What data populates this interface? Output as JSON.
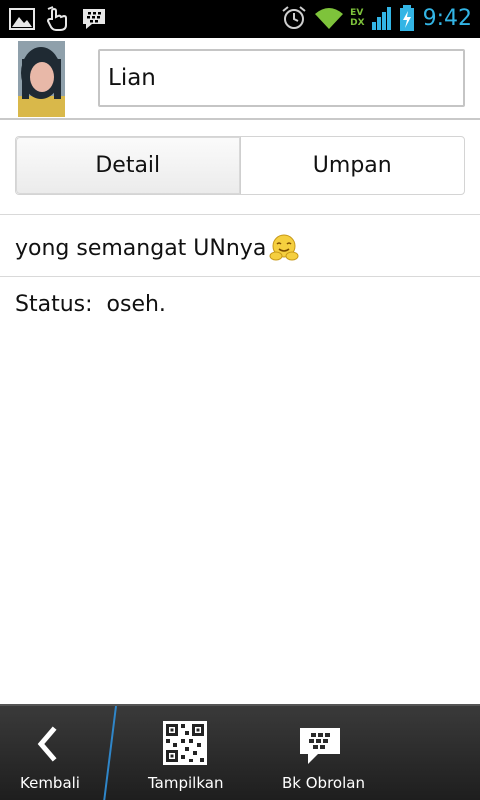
{
  "status_bar": {
    "network_labels": [
      "EV",
      "DX"
    ],
    "time": "9:42",
    "accent_color": "#33b5e5"
  },
  "profile": {
    "avatar_icon": "contact-avatar",
    "name": "Lian"
  },
  "tabs": [
    {
      "label": "Detail",
      "active": true
    },
    {
      "label": "Umpan",
      "active": false
    }
  ],
  "message": {
    "text": "yong semangat UNnya",
    "emoji_icon": "hug-emoji-icon"
  },
  "status": {
    "label": "Status:",
    "value": "oseh."
  },
  "bottom_bar": {
    "back_label": "Kembali",
    "show_label": "Tampilkan",
    "chat_label": "Bk Obrolan"
  }
}
